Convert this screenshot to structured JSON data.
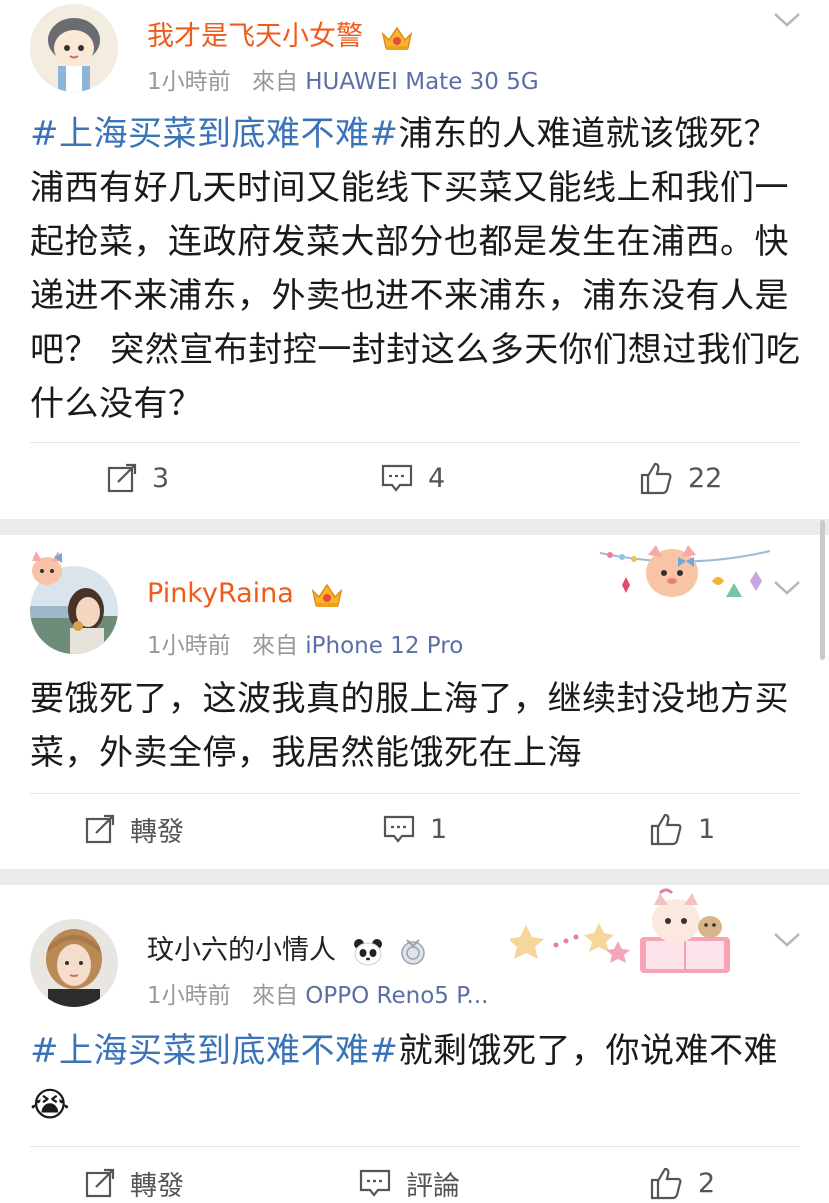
{
  "posts": [
    {
      "username": "我才是飞天小女警",
      "time": "1小時前",
      "from_label": "來自",
      "device": "HUAWEI Mate 30 5G",
      "hashtag": "#上海买菜到底难不难#",
      "text": "浦东的人难道就该饿死？浦西有好几天时间又能线下买菜又能线上和我们一起抢菜，连政府发菜大部分也都是发生在浦西。快递进不来浦东，外卖也进不来浦东，浦东没有人是吧？ 突然宣布封控一封封这么多天你们想过我们吃什么没有？",
      "repost": "3",
      "comment": "4",
      "like": "22"
    },
    {
      "username": "PinkyRaina",
      "time": "1小時前",
      "from_label": "來自",
      "device": "iPhone 12 Pro",
      "text": "要饿死了，这波我真的服上海了，继续封没地方买菜，外卖全停，我居然能饿死在上海",
      "repost": "轉發",
      "comment": "1",
      "like": "1"
    },
    {
      "username": "玟小六的小情人",
      "time": "1小時前",
      "from_label": "來自",
      "device": "OPPO Reno5 P...",
      "hashtag": "#上海买菜到底难不难#",
      "text": "就剩饿死了，你说难不难",
      "emoji": "😭",
      "repost": "轉發",
      "comment": "評論",
      "like": "2"
    }
  ],
  "colors": {
    "vip_name": "#f05a1a",
    "link_blue": "#3b73b9",
    "meta_gray": "#999999",
    "separator": "#ececec"
  },
  "icons": [
    "repost-icon",
    "comment-icon",
    "like-icon",
    "chevron-down-icon",
    "vip-crown-icon",
    "panda-icon",
    "medal-icon"
  ]
}
